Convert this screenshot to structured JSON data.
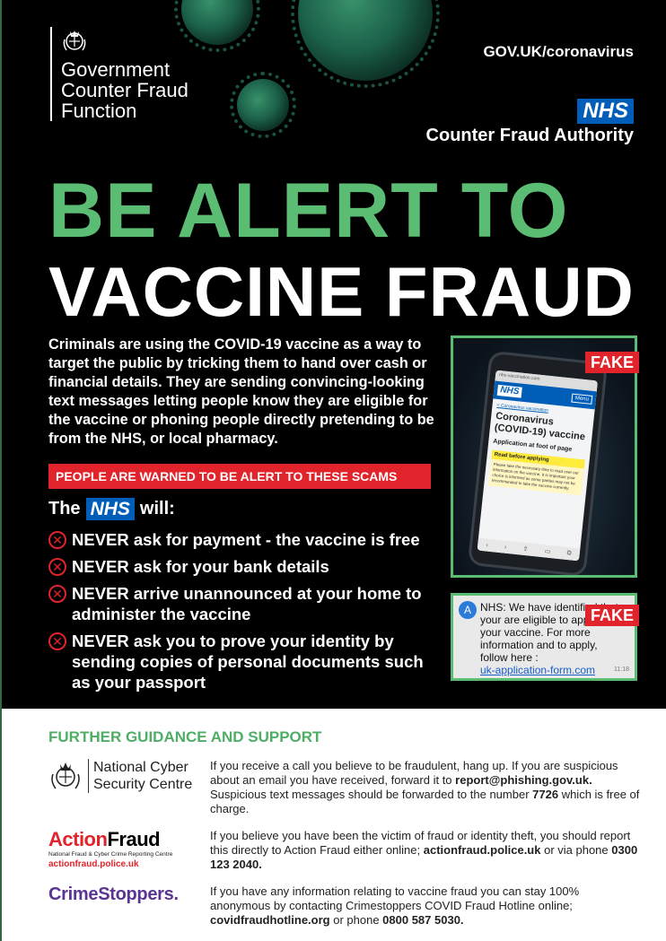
{
  "header": {
    "org_lines": [
      "Government",
      "Counter Fraud",
      "Function"
    ],
    "govuk_link": "GOV.UK/coronavirus",
    "nhs_logo": "NHS",
    "authority": "Counter Fraud Authority"
  },
  "headline": {
    "line1": "BE ALERT TO",
    "line2": "VACCINE FRAUD"
  },
  "intro": "Criminals are using the COVID-19 vaccine as a way to target the public by tricking them to hand over cash or financial details. They are sending convincing-looking text messages letting people know they are eligible for the vaccine or phoning people directly pretending to be from the NHS, or local pharmacy.",
  "warning_banner": "PEOPLE ARE WARNED TO BE ALERT TO THESE SCAMS",
  "nhs_will": {
    "prefix": "The",
    "logo": "NHS",
    "suffix": "will:",
    "items": [
      "NEVER ask for payment - the vaccine is free",
      "NEVER ask for your bank details",
      "NEVER arrive unannounced at your home to administer the vaccine",
      "NEVER ask you to prove your identity by sending copies of personal documents such as your passport"
    ]
  },
  "fake_label": "FAKE",
  "phone_screen": {
    "url": "nhs-vaccination.com",
    "logo": "NHS",
    "menu": "Menu",
    "crumb": "< Coronavirus vaccination",
    "title": "Coronavirus (COVID-19) vaccine",
    "subtitle": "Application at foot of page",
    "notice": "Read before applying",
    "body": "Please take the necessary time to read over our information on the vaccine. It is important your choice is informed as some parties may not be recommended to take the vaccine currently."
  },
  "sms": {
    "avatar": "A",
    "text": "NHS: We have identified that your are eligible to apply for your vaccine. For more information and to apply, follow here :",
    "link": "uk-application-form.com",
    "time": "11:18"
  },
  "guidance": {
    "title": "FURTHER GUIDANCE AND SUPPORT",
    "ncsc_name": [
      "National Cyber",
      "Security Centre"
    ],
    "ncsc_text_1": "If you receive a call you believe to be fraudulent, hang up. If you are suspicious about an email you have received, forward it to ",
    "ncsc_email": "report@phishing.gov.uk.",
    "ncsc_text_2": " Suspicious text messages should be forwarded to the number ",
    "ncsc_number": "7726",
    "ncsc_text_3": " which is free of charge.",
    "af_action": "Action",
    "af_fraud": "Fraud",
    "af_tagline": "National Fraud & Cyber Crime Reporting Centre",
    "af_url": "actionfraud.police.uk",
    "af_text_1": "If you believe you have been the victim of fraud or identity theft, you should report this directly to Action Fraud either online; ",
    "af_link": "actionfraud.police.uk",
    "af_text_2": " or via phone ",
    "af_phone": "0300 123 2040.",
    "cs_brand": "CrimeStoppers.",
    "cs_text_1": "If you have any information relating to vaccine fraud you can stay 100% anonymous by contacting Crimestoppers COVID Fraud Hotline online; ",
    "cs_link": "covidfraudhotline.org",
    "cs_text_2": " or phone ",
    "cs_phone": "0800 587 5030."
  },
  "colors": {
    "headline_green": "#5bbd73",
    "nhs_blue": "#005eb8",
    "alert_red": "#e1232b",
    "crimestoppers_purple": "#5a3494"
  }
}
